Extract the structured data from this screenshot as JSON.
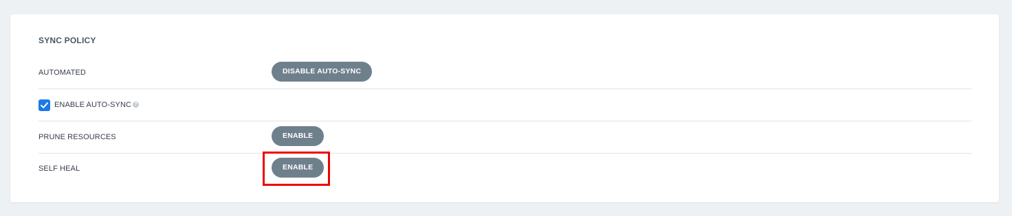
{
  "sync_policy": {
    "title": "SYNC POLICY",
    "rows": [
      {
        "label": "AUTOMATED",
        "button": "DISABLE AUTO-SYNC"
      },
      {
        "label": "ENABLE AUTO-SYNC",
        "checked": true,
        "help_icon": "help-circle-icon"
      },
      {
        "label": "PRUNE RESOURCES",
        "button": "ENABLE"
      },
      {
        "label": "SELF HEAL",
        "button": "ENABLE"
      }
    ]
  },
  "colors": {
    "checkbox": "#1b79e8",
    "button_bg": "#6f808d",
    "highlight": "#ee0000"
  }
}
